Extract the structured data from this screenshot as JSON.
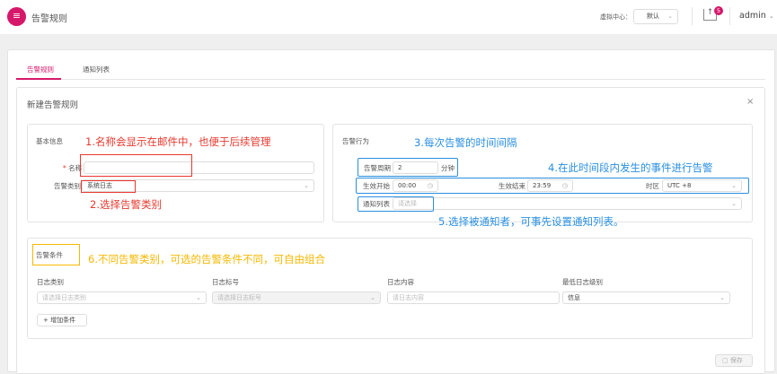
{
  "header": {
    "title": "告警规则",
    "vc_label": "虚拟中心：",
    "vc_value": "默认",
    "badge": "5",
    "user": "admin"
  },
  "tabs": [
    {
      "label": "告警规则",
      "active": true
    },
    {
      "label": "通知列表",
      "active": false
    }
  ],
  "panel": {
    "title": "新建告警规则",
    "close": "×"
  },
  "basic": {
    "title": "基本信息",
    "name_label": "名称",
    "name_required": "*",
    "name_value": "",
    "type_label": "告警类别",
    "type_value": "系统日志"
  },
  "behavior": {
    "title": "告警行为",
    "period_label": "告警周期",
    "period_value": "2",
    "period_unit": "分钟",
    "start_label": "生效开始",
    "start_value": "00:00",
    "end_label": "生效结束",
    "end_value": "23:59",
    "tz_label": "时区",
    "tz_value": "UTC +8",
    "notify_label": "通知列表",
    "notify_placeholder": "请选择"
  },
  "conditions": {
    "title": "告警条件",
    "columns": [
      {
        "label": "日志类别",
        "placeholder": "请选择日志类别"
      },
      {
        "label": "日志标号",
        "placeholder": "请选择日志标号"
      },
      {
        "label": "日志内容",
        "placeholder": "请日志内容"
      },
      {
        "label": "最低日志级别",
        "value": "信息"
      }
    ],
    "add_label": "增加条件"
  },
  "save_label": "保存",
  "annotations": [
    "1.名称会显示在邮件中，也便于后续管理",
    "2.选择告警类别",
    "3.每次告警的时间间隔",
    "4.在此时间段内发生的事件进行告警",
    "5.选择被通知者，可事先设置通知列表。",
    "6.不同告警类别，可选的告警条件不同，可自由组合"
  ],
  "colors": {
    "brand": "#d6186a",
    "annotation_red": "#e8392f",
    "annotation_blue": "#2a8fe0",
    "annotation_orange": "#f5b800"
  }
}
